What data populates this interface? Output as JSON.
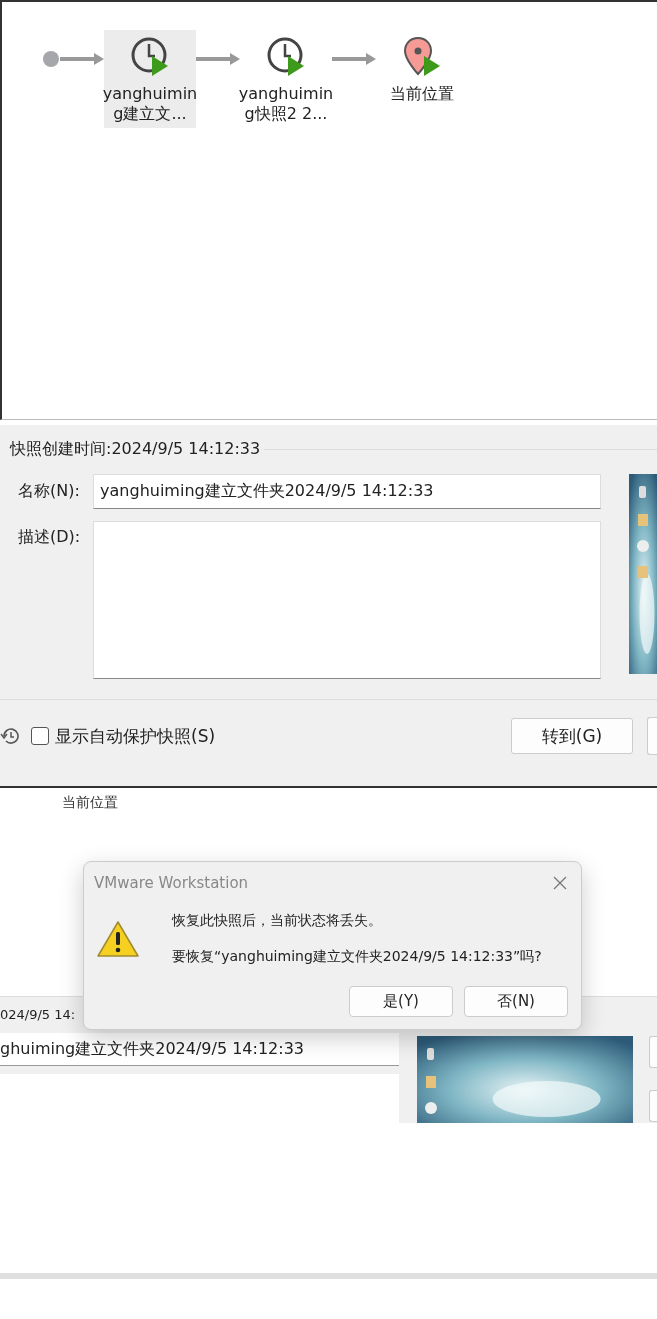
{
  "snapshot_tree": {
    "nodes": [
      {
        "kind": "root"
      },
      {
        "kind": "snapshot",
        "lines": [
          "yanghuimin",
          "g建立文..."
        ],
        "selected": true
      },
      {
        "kind": "snapshot",
        "lines": [
          "yanghuimin",
          "g快照2 2..."
        ],
        "selected": false
      },
      {
        "kind": "current",
        "lines": [
          "当前位置"
        ],
        "selected": false
      }
    ]
  },
  "details": {
    "created": "快照创建时间:2024/9/5 14:12:33",
    "name_label": "名称(N):",
    "name_value": "yanghuiming建立文件夹2024/9/5 14:12:33",
    "description_label": "描述(D):",
    "show_autoprotect": {
      "label": "显示自动保护快照(S)",
      "checked": false
    },
    "buttons": [
      "转到(G)"
    ]
  },
  "background": {
    "current_label": "当前位置",
    "created_fragment": "024/9/5 14:",
    "name_fragment": "ghuiming建立文件夹2024/9/5 14:12:33"
  },
  "dialog": {
    "title": "VMware Workstation",
    "message": "恢复此快照后，当前状态将丢失。",
    "question": "要恢复“yanghuiming建立文件夹2024/9/5 14:12:33”吗?",
    "buttons": [
      "是(Y)",
      "否(N)"
    ]
  }
}
